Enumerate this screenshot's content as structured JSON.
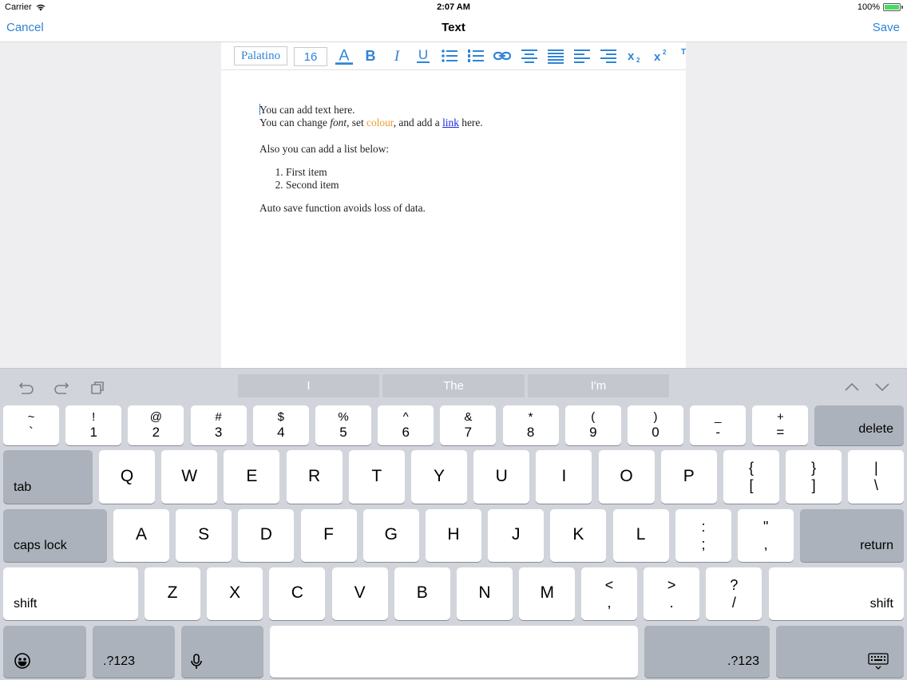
{
  "status_bar": {
    "carrier": "Carrier",
    "time": "2:07 AM",
    "battery": "100%",
    "battery_level": 1.0
  },
  "nav": {
    "cancel": "Cancel",
    "title": "Text",
    "save": "Save"
  },
  "toolbar": {
    "font": "Palatino",
    "size": "16",
    "icons": [
      "text-color-icon",
      "bold-icon",
      "italic-icon",
      "underline-icon",
      "bullet-list-icon",
      "numbered-list-icon",
      "link-icon",
      "align-center-icon",
      "align-justify-icon",
      "align-left-icon",
      "align-right-icon",
      "subscript-icon",
      "superscript-icon"
    ],
    "accent": "#2f84d6"
  },
  "document": {
    "line1": "You can add text here.",
    "line2_a": "You can change ",
    "line2_font": "font",
    "line2_b": ", set ",
    "line2_colour": "colour",
    "line2_c": ", and add a ",
    "line2_link": "link",
    "line2_d": " here.",
    "line3": "Also you can add a list below:",
    "list": [
      "First item",
      "Second item"
    ],
    "line4": "Auto save function avoids loss of data.",
    "colour_color": "#ef9a2b",
    "link_color": "#1a28d8"
  },
  "keyboard": {
    "suggestions": [
      "I",
      "The",
      "I'm"
    ],
    "shortcut_icons": [
      "undo-icon",
      "redo-icon",
      "paste-icon"
    ],
    "row1": [
      {
        "top": "~",
        "bot": "`"
      },
      {
        "top": "!",
        "bot": "1"
      },
      {
        "top": "@",
        "bot": "2"
      },
      {
        "top": "#",
        "bot": "3"
      },
      {
        "top": "$",
        "bot": "4"
      },
      {
        "top": "%",
        "bot": "5"
      },
      {
        "top": "^",
        "bot": "6"
      },
      {
        "top": "&",
        "bot": "7"
      },
      {
        "top": "*",
        "bot": "8"
      },
      {
        "top": "(",
        "bot": "9"
      },
      {
        "top": ")",
        "bot": "0"
      },
      {
        "top": "_",
        "bot": "-"
      },
      {
        "top": "+",
        "bot": "="
      }
    ],
    "delete": "delete",
    "tab": "tab",
    "row2": [
      "Q",
      "W",
      "E",
      "R",
      "T",
      "Y",
      "U",
      "I",
      "O",
      "P"
    ],
    "row2_sym": [
      {
        "top": "{",
        "bot": "["
      },
      {
        "top": "}",
        "bot": "]"
      },
      {
        "top": "|",
        "bot": "\\"
      }
    ],
    "caps_lock": "caps lock",
    "row3": [
      "A",
      "S",
      "D",
      "F",
      "G",
      "H",
      "J",
      "K",
      "L"
    ],
    "row3_sym": [
      {
        "top": ":",
        "bot": ";"
      },
      {
        "top": "\"",
        "bot": ","
      }
    ],
    "return": "return",
    "shift": "shift",
    "row4": [
      "Z",
      "X",
      "C",
      "V",
      "B",
      "N",
      "M"
    ],
    "row4_sym": [
      {
        "top": "<",
        "bot": ","
      },
      {
        "top": ">",
        "bot": "."
      },
      {
        "top": "?",
        "bot": "/"
      }
    ],
    "numbers_label": ".?123"
  }
}
